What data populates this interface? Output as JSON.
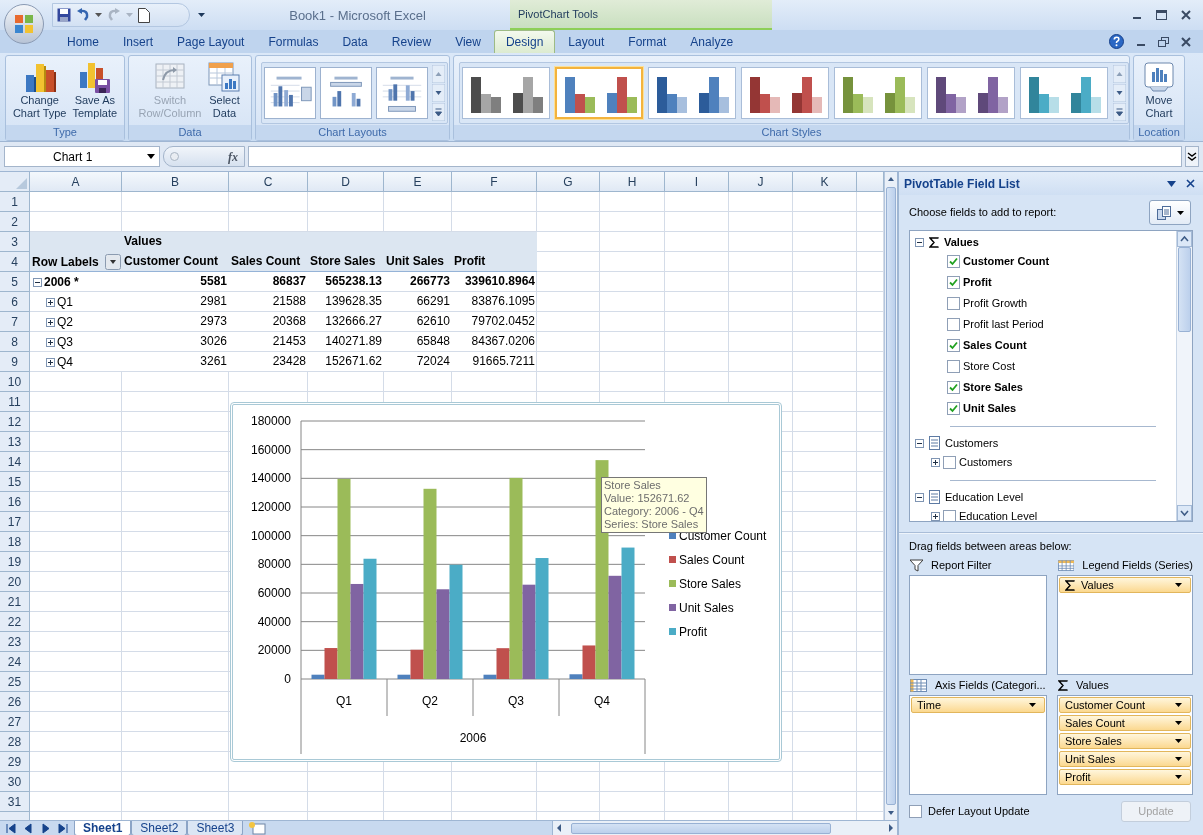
{
  "window": {
    "title": "Book1 - Microsoft Excel",
    "context_group": "PivotChart Tools"
  },
  "ribbon_tabs": [
    {
      "label": "Home",
      "selected": false
    },
    {
      "label": "Insert",
      "selected": false
    },
    {
      "label": "Page Layout",
      "selected": false
    },
    {
      "label": "Formulas",
      "selected": false
    },
    {
      "label": "Data",
      "selected": false
    },
    {
      "label": "Review",
      "selected": false
    },
    {
      "label": "View",
      "selected": false
    },
    {
      "label": "Design",
      "selected": true
    },
    {
      "label": "Layout",
      "selected": false
    },
    {
      "label": "Format",
      "selected": false
    },
    {
      "label": "Analyze",
      "selected": false
    }
  ],
  "ribbon_groups": [
    {
      "label": "Type",
      "kind": "buttons",
      "buttons": [
        {
          "kind": "chart-type",
          "lines": [
            "Change",
            "Chart Type"
          ],
          "disabled": false
        },
        {
          "kind": "template",
          "lines": [
            "Save As",
            "Template"
          ],
          "disabled": false
        }
      ]
    },
    {
      "label": "Data",
      "kind": "buttons",
      "buttons": [
        {
          "kind": "switch",
          "lines": [
            "Switch",
            "Row/Column"
          ],
          "disabled": true
        },
        {
          "kind": "select-data",
          "lines": [
            "Select",
            "Data"
          ],
          "disabled": false
        }
      ]
    },
    {
      "label": "Chart Layouts",
      "kind": "layouts",
      "layouts": [
        {
          "kind": "legend-right",
          "selected": false
        },
        {
          "kind": "title-top",
          "selected": false
        },
        {
          "kind": "legend-bottom",
          "selected": false
        }
      ]
    },
    {
      "label": "Chart Styles",
      "kind": "styles",
      "styles": [
        {
          "kind": "grey",
          "selected": false
        },
        {
          "kind": "colorful",
          "selected": true
        },
        {
          "kind": "blue",
          "selected": false
        },
        {
          "kind": "red",
          "selected": false
        },
        {
          "kind": "green",
          "selected": false
        },
        {
          "kind": "purple",
          "selected": false
        },
        {
          "kind": "aqua",
          "selected": false
        }
      ]
    },
    {
      "label": "Location",
      "kind": "buttons",
      "buttons": [
        {
          "kind": "move-chart",
          "lines": [
            "Move",
            "Chart"
          ],
          "disabled": false
        }
      ]
    }
  ],
  "formula_bar": {
    "name_box": "Chart 1",
    "function_label": "fx"
  },
  "sheet": {
    "columns": [
      "A",
      "B",
      "C",
      "D",
      "E",
      "F",
      "G",
      "H",
      "I",
      "J",
      "K"
    ],
    "row_numbers": [
      "1",
      "2",
      "3",
      "4",
      "5",
      "6",
      "7",
      "8",
      "9",
      "10",
      "11",
      "12",
      "13",
      "14",
      "15",
      "16",
      "17",
      "18",
      "19",
      "20",
      "21",
      "22",
      "23",
      "24",
      "25",
      "26",
      "27",
      "28",
      "29",
      "30",
      "31"
    ]
  },
  "pivot": {
    "values_caption": "Values",
    "row_labels_caption": "Row Labels",
    "columns": [
      "Customer Count",
      "Sales Count",
      "Store Sales",
      "Unit Sales",
      "Profit"
    ],
    "rows": [
      {
        "label": "2006 *",
        "kind": "total",
        "expanded": true,
        "cells": [
          "5581",
          "86837",
          "565238.13",
          "266773",
          "339610.8964"
        ]
      },
      {
        "label": "Q1",
        "kind": "detail",
        "expanded": false,
        "cells": [
          "2981",
          "21588",
          "139628.35",
          "66291",
          "83876.1095"
        ]
      },
      {
        "label": "Q2",
        "kind": "detail",
        "expanded": false,
        "cells": [
          "2973",
          "20368",
          "132666.27",
          "62610",
          "79702.0452"
        ]
      },
      {
        "label": "Q3",
        "kind": "detail",
        "expanded": false,
        "cells": [
          "3026",
          "21453",
          "140271.89",
          "65848",
          "84367.0206"
        ]
      },
      {
        "label": "Q4",
        "kind": "detail",
        "expanded": false,
        "cells": [
          "3261",
          "23428",
          "152671.62",
          "72024",
          "91665.7211"
        ]
      }
    ]
  },
  "chart": {
    "chart_data": {
      "type": "bar",
      "categories": [
        "Q1",
        "Q2",
        "Q3",
        "Q4"
      ],
      "xlabel": "2006",
      "ylim": [
        0,
        180000
      ],
      "yticks": [
        0,
        20000,
        40000,
        60000,
        80000,
        100000,
        120000,
        140000,
        160000,
        180000
      ],
      "grid": true,
      "legend": "right",
      "series": [
        {
          "name": "Customer Count",
          "color": "#4f81bd",
          "values": [
            3000,
            3000,
            3000,
            3300
          ]
        },
        {
          "name": "Sales Count",
          "color": "#c0504d",
          "values": [
            21600,
            20400,
            21500,
            23400
          ]
        },
        {
          "name": "Store Sales",
          "color": "#9bbb59",
          "values": [
            139600,
            132700,
            140300,
            152700
          ]
        },
        {
          "name": "Unit Sales",
          "color": "#8064a2",
          "values": [
            66300,
            62600,
            65800,
            72000
          ]
        },
        {
          "name": "Profit",
          "color": "#4bacc6",
          "values": [
            83900,
            79700,
            84400,
            91700
          ]
        }
      ]
    },
    "tooltip": {
      "lines": [
        "Store Sales",
        "Value: 152671.62",
        "Category: 2006 - Q4",
        "Series: Store Sales"
      ]
    }
  },
  "field_list": {
    "title": "PivotTable Field List",
    "prompt": "Choose fields to add to report:",
    "tree": [
      {
        "label": "Values",
        "kind": "values",
        "expanded": true,
        "children": [
          {
            "label": "Customer Count",
            "checked": true
          },
          {
            "label": "Profit",
            "checked": true
          },
          {
            "label": "Profit Growth",
            "checked": false
          },
          {
            "label": "Profit last Period",
            "checked": false
          },
          {
            "label": "Sales Count",
            "checked": true
          },
          {
            "label": "Store Cost",
            "checked": false
          },
          {
            "label": "Store Sales",
            "checked": true
          },
          {
            "label": "Unit Sales",
            "checked": true
          }
        ]
      },
      {
        "label": "Customers",
        "kind": "dimension",
        "expanded": true,
        "children": [
          {
            "label": "Customers",
            "checked": false,
            "expanded": false
          }
        ]
      },
      {
        "label": "Education Level",
        "kind": "dimension",
        "expanded": true,
        "children": [
          {
            "label": "Education Level",
            "checked": false,
            "expanded": false
          }
        ]
      }
    ],
    "areas_prompt": "Drag fields between areas below:",
    "areas": [
      {
        "label": "Report Filter",
        "kind": "filter"
      },
      {
        "label": "Legend Fields (Series)",
        "kind": "legend",
        "items": [
          {
            "label": "Values",
            "kind": "values"
          }
        ]
      },
      {
        "label": "Axis Fields (Categori...",
        "kind": "axis",
        "items": [
          {
            "label": "Time",
            "kind": "field"
          }
        ]
      },
      {
        "label": "Values",
        "kind": "values",
        "items": [
          {
            "label": "Customer Count",
            "kind": "field"
          },
          {
            "label": "Sales Count",
            "kind": "field"
          },
          {
            "label": "Store Sales",
            "kind": "field"
          },
          {
            "label": "Unit Sales",
            "kind": "field"
          },
          {
            "label": "Profit",
            "kind": "field"
          }
        ]
      }
    ],
    "defer": {
      "label": "Defer Layout Update",
      "checked": false
    },
    "update_button": {
      "label": "Update",
      "disabled": true
    }
  },
  "sheet_tabs": [
    {
      "label": "Sheet1",
      "selected": true
    },
    {
      "label": "Sheet2",
      "selected": false
    },
    {
      "label": "Sheet3",
      "selected": false
    }
  ]
}
